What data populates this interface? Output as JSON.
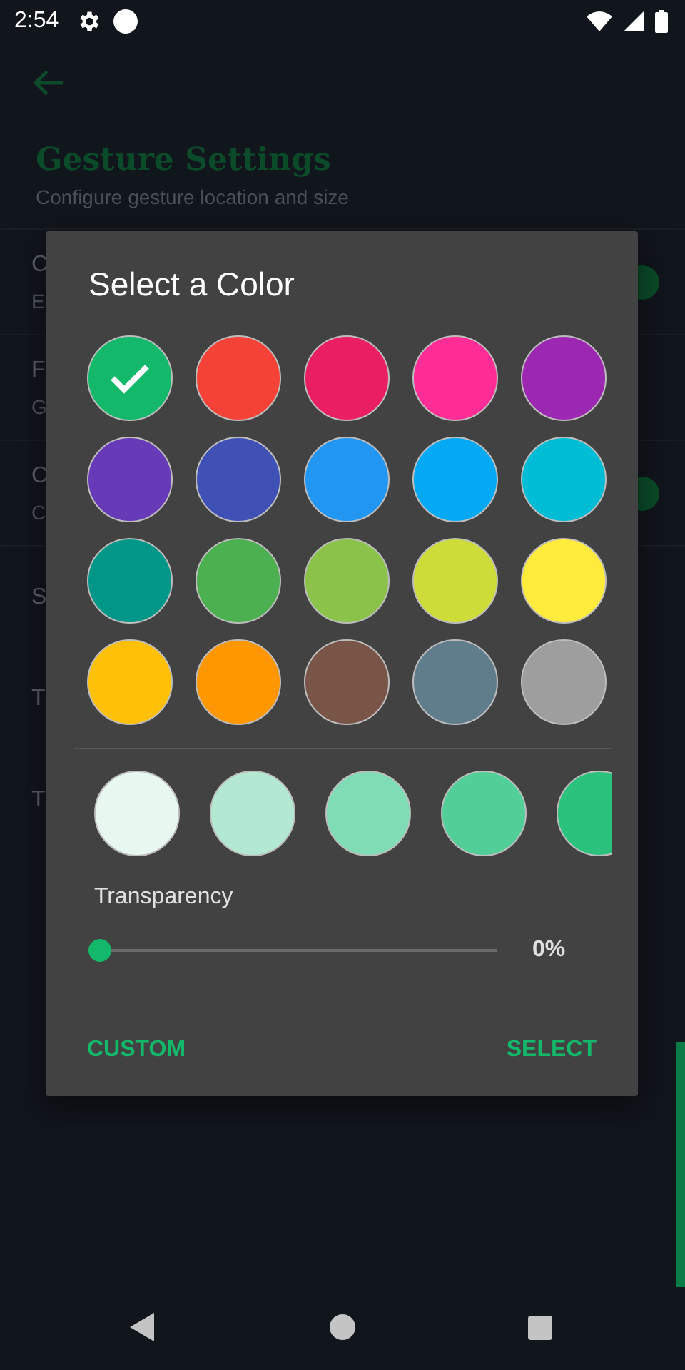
{
  "status_bar": {
    "time": "2:54"
  },
  "header": {
    "title": "Gesture Settings",
    "subtitle": "Configure gesture location and size"
  },
  "settings": [
    {
      "title": "C",
      "subtitle": "E",
      "kind": "toggle",
      "on": true
    },
    {
      "title": "F",
      "subtitle": "G",
      "kind": "plain"
    },
    {
      "title": "C",
      "subtitle": "C",
      "kind": "toggle",
      "on": true
    },
    {
      "title": "S",
      "kind": "plain"
    },
    {
      "title": "T",
      "kind": "plain"
    },
    {
      "title": "T",
      "kind": "plain"
    }
  ],
  "dialog": {
    "title": "Select a Color",
    "colors": [
      {
        "color": "#13b86a",
        "selected": true
      },
      {
        "color": "#f44336",
        "selected": false
      },
      {
        "color": "#e91e63",
        "selected": false
      },
      {
        "color": "#ff2d95",
        "selected": false
      },
      {
        "color": "#9c27b0",
        "selected": false
      },
      {
        "color": "#673ab7",
        "selected": false
      },
      {
        "color": "#3f51b5",
        "selected": false
      },
      {
        "color": "#2196f3",
        "selected": false
      },
      {
        "color": "#03a9f4",
        "selected": false
      },
      {
        "color": "#00bcd4",
        "selected": false
      },
      {
        "color": "#009688",
        "selected": false
      },
      {
        "color": "#4caf50",
        "selected": false
      },
      {
        "color": "#8bc34a",
        "selected": false
      },
      {
        "color": "#cddc39",
        "selected": false
      },
      {
        "color": "#ffeb3b",
        "selected": false
      },
      {
        "color": "#ffc107",
        "selected": false
      },
      {
        "color": "#ff9800",
        "selected": false
      },
      {
        "color": "#795548",
        "selected": false
      },
      {
        "color": "#607d8b",
        "selected": false
      },
      {
        "color": "#9e9e9e",
        "selected": false
      }
    ],
    "shades": [
      {
        "color": "#e8f8f0"
      },
      {
        "color": "#b3e9d2"
      },
      {
        "color": "#80dcb5"
      },
      {
        "color": "#52cf98"
      },
      {
        "color": "#2bc27e"
      }
    ],
    "transparency": {
      "label": "Transparency",
      "level": 0,
      "reading": "0%"
    },
    "buttons": [
      "CUSTOM",
      "SELECT"
    ]
  }
}
